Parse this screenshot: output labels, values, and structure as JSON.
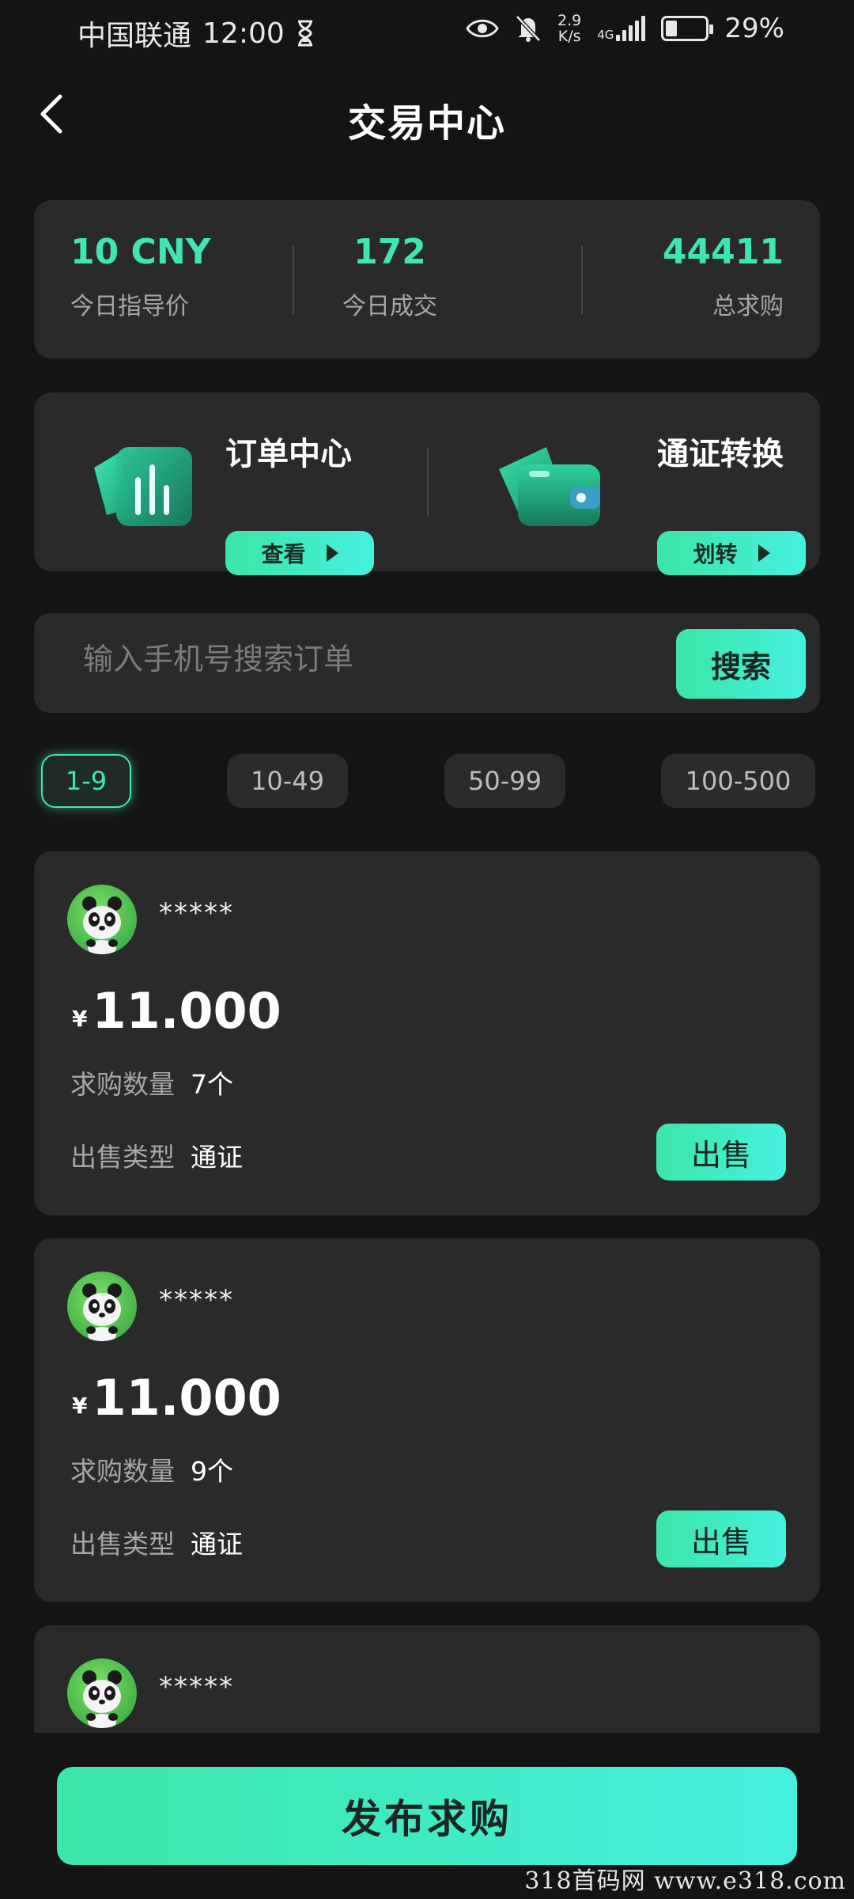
{
  "status_bar": {
    "carrier": "中国联通",
    "time": "12:00",
    "net_speed_value": "2.9",
    "net_speed_unit": "K/s",
    "network_type": "4G",
    "battery_percent": "29%",
    "battery_level": 0.29
  },
  "header": {
    "title": "交易中心"
  },
  "stats": [
    {
      "value": "10 CNY",
      "label": "今日指导价"
    },
    {
      "value": "172",
      "label": "今日成交"
    },
    {
      "value": "44411",
      "label": "总求购"
    }
  ],
  "quick_links": [
    {
      "title": "订单中心",
      "button": "查看",
      "icon": "chart-bars-icon"
    },
    {
      "title": "通证转换",
      "button": "划转",
      "icon": "wallet-icon"
    }
  ],
  "search": {
    "placeholder": "输入手机号搜索订单",
    "button": "搜索"
  },
  "range_tabs": [
    {
      "label": "1-9",
      "active": true
    },
    {
      "label": "10-49",
      "active": false
    },
    {
      "label": "50-99",
      "active": false
    },
    {
      "label": "100-500",
      "active": false
    }
  ],
  "orders": [
    {
      "user": "*****",
      "currency": "¥",
      "price": "11.000",
      "qty_label": "求购数量",
      "qty": "7个",
      "type_label": "出售类型",
      "type": "通证",
      "action": "出售"
    },
    {
      "user": "*****",
      "currency": "¥",
      "price": "11.000",
      "qty_label": "求购数量",
      "qty": "9个",
      "type_label": "出售类型",
      "type": "通证",
      "action": "出售"
    },
    {
      "user": "*****"
    }
  ],
  "publish_button": "发布求购",
  "watermark": "318首码网  www.e318.com",
  "colors": {
    "accent": "#3fe6b3",
    "accent_end": "#46f0e0",
    "background": "#141414",
    "card": "#2a2a2a"
  }
}
